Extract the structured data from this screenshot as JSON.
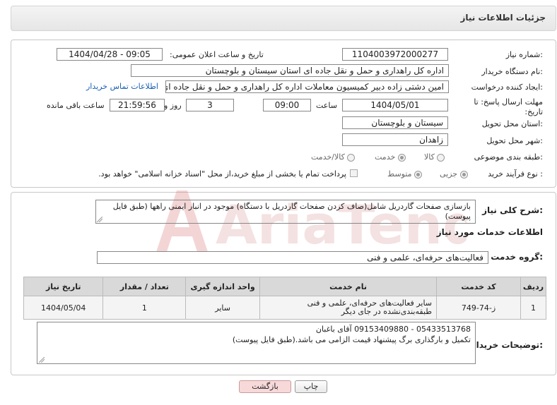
{
  "header": {
    "title": "جزئیات اطلاعات نیاز"
  },
  "fields": {
    "need_number_label": "شماره نیاز:",
    "need_number": "1104003972000277",
    "announce_label": "تاریخ و ساعت اعلان عمومی:",
    "announce_value": "1404/04/28 - 09:05",
    "buyer_org_label": "نام دستگاه خریدار:",
    "buyer_org": "اداره کل راهداری و حمل و نقل جاده ای استان سیستان و بلوچستان",
    "creator_label": "ایجاد کننده درخواست:",
    "creator": "امین دشتی زاده دبیر کمیسیون معاملات اداره کل راهداری و حمل و نقل جاده ای",
    "contact_link": "اطلاعات تماس خریدار",
    "deadline_label": "مهلت ارسال پاسخ: تا تاریخ:",
    "deadline_date": "1404/05/01",
    "time_label": "ساعت",
    "deadline_time": "09:00",
    "days_value": "3",
    "days_label": "روز و",
    "remaining_time": "21:59:56",
    "remaining_label": "ساعت باقی مانده",
    "province_label": "استان محل تحویل:",
    "province": "سیستان و بلوچستان",
    "city_label": "شهر محل تحویل:",
    "city": "زاهدان",
    "category_label": "طبقه بندی موضوعی:",
    "category_options": [
      "کالا",
      "خدمت",
      "کالا/خدمت"
    ],
    "category_selected": "خدمت",
    "process_label": "نوع فرآیند خرید :",
    "process_options": [
      "جزیی",
      "متوسط"
    ],
    "process_selected": "جزیی",
    "payment_text": "پرداخت تمام یا بخشی از مبلغ خرید،از محل \"اسناد خزانه اسلامی\" خواهد بود."
  },
  "summary": {
    "label": "شرح کلی نیاز:",
    "text": "بازسازی صفحات گاردریل شامل(صاف کردن صفحات گاردریل با دستگاه) موجود در انبار ایمنی راهها (طبق فایل پیوست)"
  },
  "services": {
    "section_title": "اطلاعات خدمات مورد نیاز",
    "group_label": "گروه خدمت:",
    "group_value": "فعالیت‌های حرفه‌ای، علمی و فنی",
    "table": {
      "headers": [
        "ردیف",
        "کد خدمت",
        "نام خدمت",
        "واحد اندازه گیری",
        "تعداد / مقدار",
        "تاریخ نیاز"
      ],
      "rows": [
        [
          "1",
          "ز-74-749",
          "سایر فعالیت‌های حرفه‌ای، علمی و فنی طبقه‌بندی‌نشده در جای دیگر",
          "سایر",
          "1",
          "1404/05/04"
        ]
      ]
    }
  },
  "buyer_notes": {
    "label": "توضیحات خریدار:",
    "line1": "05433513768 - 09153409880 آقای باغبان",
    "line2": "تکمیل و بارگذاری برگ پیشنهاد قیمت الزامی می باشد.(طبق فایل پیوست)"
  },
  "buttons": {
    "print": "چاپ",
    "back": "بازگشت"
  },
  "watermark_text": "AriaTender.neT",
  "colors": {
    "link": "#1a5fb4",
    "back_button": "#f7d9d9",
    "watermark": "#e8b9b9"
  }
}
